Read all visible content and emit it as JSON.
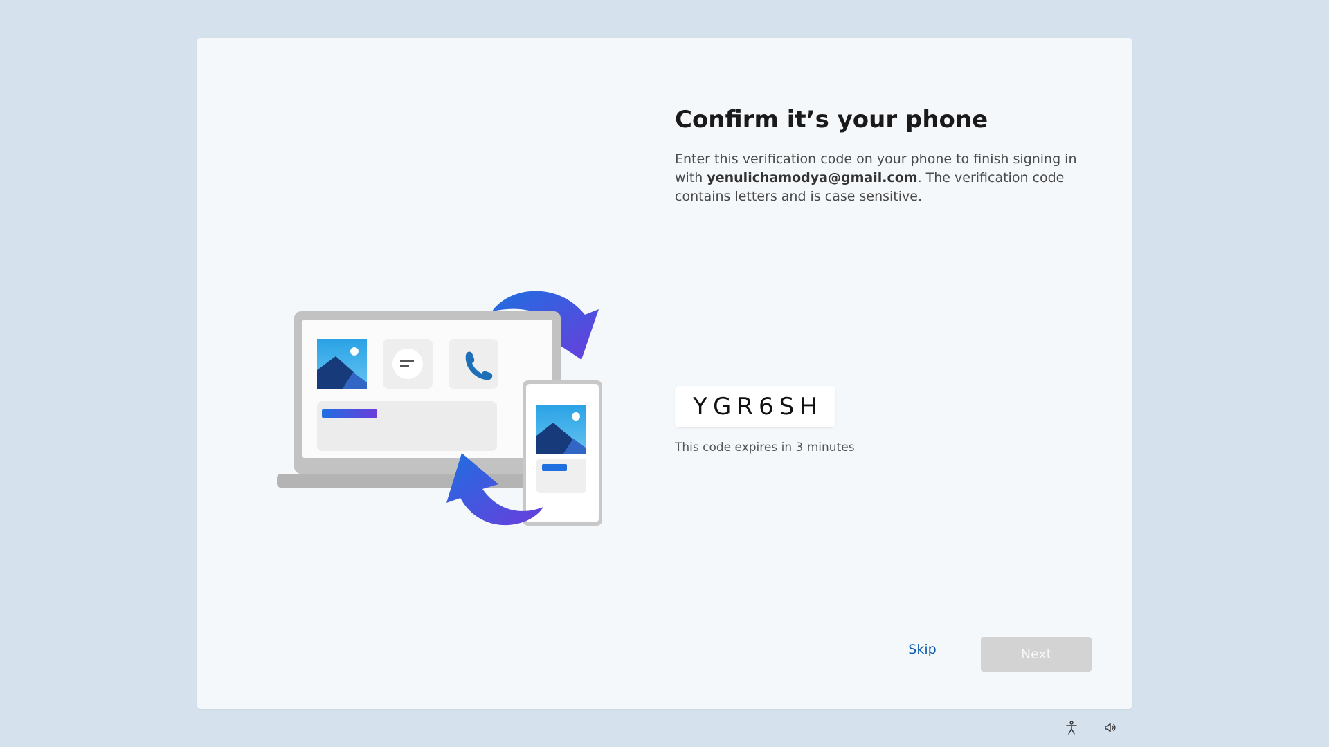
{
  "page": {
    "title": "Confirm it’s your phone",
    "description_before": "Enter this verification code on your phone to finish signing in with ",
    "email": "yenulichamodya@gmail.com",
    "description_after": ". The verification code contains letters and is case sensitive.",
    "verification_code": "YGR6SH",
    "expires_text": "This code expires in 3 minutes"
  },
  "buttons": {
    "skip_label": "Skip",
    "next_label": "Next"
  },
  "tray": {
    "icons": [
      "accessibility-icon",
      "volume-icon"
    ]
  },
  "colors": {
    "background": "#d5e2ed",
    "card": "#f4f8fb",
    "link": "#0b5cad",
    "next_disabled": "#d3d3d3",
    "arrow_start": "#1f6fe0",
    "arrow_end": "#6a3ddc"
  }
}
